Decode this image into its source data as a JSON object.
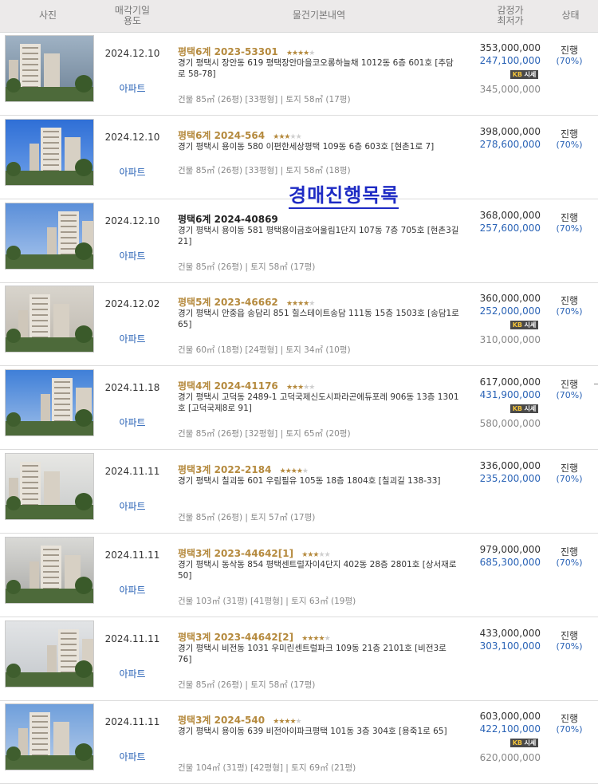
{
  "header": {
    "photo": "사진",
    "date_line1": "매각기일",
    "date_line2": "용도",
    "info": "물건기본내역",
    "price_line1": "감정가",
    "price_line2": "최저가",
    "status": "상태"
  },
  "watermark": "경매진행목록",
  "colors": {
    "accent_gold": "#b58a3e",
    "accent_blue": "#2a63b6",
    "header_bg": "#eceaea"
  },
  "rows": [
    {
      "date": "2024.12.10",
      "usage": "아파트",
      "case": "평택6계 2023-53301",
      "stars": 4,
      "stars_half": false,
      "address": "경기 평택시 장안동 619 평택장안마을코오롱하늘채 1012동 6층 601호 [추담로 58-78]",
      "area": "건물 85㎡ (26평) [33평형]  |  토지 58㎡ (17평)",
      "appraisal": "353,000,000",
      "minimum": "247,100,000",
      "kb_badge": "시세",
      "market": "345,000,000",
      "status": "진행",
      "ratio": "(70%)"
    },
    {
      "date": "2024.12.10",
      "usage": "아파트",
      "case": "평택6계 2024-564",
      "stars": 3,
      "stars_half": false,
      "address": "경기 평택시 용이동 580 이편한세상평택 109동 6층 603호 [현촌1로 7]",
      "area": "건물 85㎡ (26평) [33평형]  |  토지 58㎡ (18평)",
      "appraisal": "398,000,000",
      "minimum": "278,600,000",
      "kb_badge": "",
      "market": "",
      "status": "진행",
      "ratio": "(70%)"
    },
    {
      "date": "2024.12.10",
      "usage": "아파트",
      "case": "평택6계 2024-40869",
      "stars": 0,
      "stars_half": false,
      "address": "경기 평택시 용이동 581 평택용이금호어울림1단지 107동 7층 705호 [현촌3길 21]",
      "area": "건물 85㎡ (26평)  |  토지 58㎡ (17평)",
      "appraisal": "368,000,000",
      "minimum": "257,600,000",
      "kb_badge": "",
      "market": "",
      "status": "진행",
      "ratio": "(70%)"
    },
    {
      "date": "2024.12.02",
      "usage": "아파트",
      "case": "평택5계 2023-46662",
      "stars": 3,
      "stars_half": true,
      "address": "경기 평택시 안중읍 송담리 851 힐스테이트송담 111동 15층 1503호 [송담1로 65]",
      "area": "건물 60㎡ (18평) [24평형]  |  토지 34㎡ (10평)",
      "appraisal": "360,000,000",
      "minimum": "252,000,000",
      "kb_badge": "시세",
      "market": "310,000,000",
      "status": "진행",
      "ratio": "(70%)"
    },
    {
      "date": "2024.11.18",
      "usage": "아파트",
      "case": "평택4계 2024-41176",
      "stars": 3,
      "stars_half": false,
      "address": "경기 평택시 고덕동 2489-1 고덕국제신도시파라곤에듀포레 906동 13층 1301호 [고덕국제8로 91]",
      "area": "건물 85㎡ (26평) [32평형]  |  토지 65㎡ (20평)",
      "appraisal": "617,000,000",
      "minimum": "431,900,000",
      "kb_badge": "시세",
      "market": "580,000,000",
      "status": "진행",
      "ratio": "(70%)"
    },
    {
      "date": "2024.11.11",
      "usage": "아파트",
      "case": "평택3계 2022-2184",
      "stars": 3,
      "stars_half": true,
      "address": "경기 평택시 칠괴동 601 우림필유 105동 18층 1804호 [칠괴길 138-33]",
      "area": "건물 85㎡ (26평)  |  토지 57㎡ (17평)",
      "appraisal": "336,000,000",
      "minimum": "235,200,000",
      "kb_badge": "",
      "market": "",
      "status": "진행",
      "ratio": "(70%)"
    },
    {
      "date": "2024.11.11",
      "usage": "아파트",
      "case": "평택3계 2023-44642[1]",
      "stars": 2,
      "stars_half": true,
      "address": "경기 평택시 동삭동 854 평택센트럴자이4단지 402동 28층 2801호 [상서재로 50]",
      "area": "건물 103㎡ (31평) [41평형]  |  토지 63㎡ (19평)",
      "appraisal": "979,000,000",
      "minimum": "685,300,000",
      "kb_badge": "",
      "market": "",
      "status": "진행",
      "ratio": "(70%)"
    },
    {
      "date": "2024.11.11",
      "usage": "아파트",
      "case": "평택3계 2023-44642[2]",
      "stars": 4,
      "stars_half": false,
      "address": "경기 평택시 비전동 1031 우미린센트럴파크 109동 21층 2101호 [비전3로 76]",
      "area": "건물 85㎡ (26평)  |  토지 58㎡ (17평)",
      "appraisal": "433,000,000",
      "minimum": "303,100,000",
      "kb_badge": "",
      "market": "",
      "status": "진행",
      "ratio": "(70%)"
    },
    {
      "date": "2024.11.11",
      "usage": "아파트",
      "case": "평택3계 2024-540",
      "stars": 4,
      "stars_half": false,
      "address": "경기 평택시 용이동 639 비전아이파크평택 101동 3층 304호 [용죽1로 65]",
      "area": "건물 104㎡ (31평) [42평형]  |  토지 69㎡ (21평)",
      "appraisal": "603,000,000",
      "minimum": "422,100,000",
      "kb_badge": "시세",
      "market": "620,000,000",
      "status": "진행",
      "ratio": "(70%)"
    }
  ]
}
